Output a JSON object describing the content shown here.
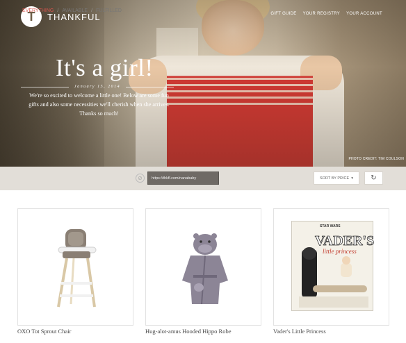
{
  "header": {
    "logo_mark": "T",
    "logo_text": "THANKFUL",
    "nav": [
      "GIFT GUIDE",
      "YOUR REGISTRY",
      "YOUR ACCOUNT"
    ]
  },
  "hero": {
    "headline": "It's a girl!",
    "date": "January 15, 2014",
    "message": "We're so excited to welcome a little one! Below are some fun gifts and also some necessities we'll cherish when she arrives. Thanks so much!",
    "credit": "PHOTO CREDIT: TIM COULSON"
  },
  "filterbar": {
    "filters": [
      "EVERYTHING",
      "AVAILABLE",
      "FULFILLED"
    ],
    "active_filter": "EVERYTHING",
    "separator": "/",
    "url": "https://thkfl.com/nanababy",
    "sort_label": "SORT BY PRICE",
    "sort_caret": "▾",
    "refresh_icon": "↻",
    "link_icon": "⊘"
  },
  "products": [
    {
      "name": "OXO Tot Sprout Chair",
      "icon": "high-chair"
    },
    {
      "name": "Hug-alot-amus Hooded Hippo Robe",
      "icon": "hippo-robe"
    },
    {
      "name": "Vader's Little Princess",
      "icon": "book-cover",
      "book_top": "STAR WARS",
      "book_title": "VADER'S",
      "book_subtitle": "little princess"
    }
  ],
  "colors": {
    "accent": "#d9544d",
    "filterbar_bg": "#e2ded8",
    "url_field_bg": "#6f6a65"
  }
}
